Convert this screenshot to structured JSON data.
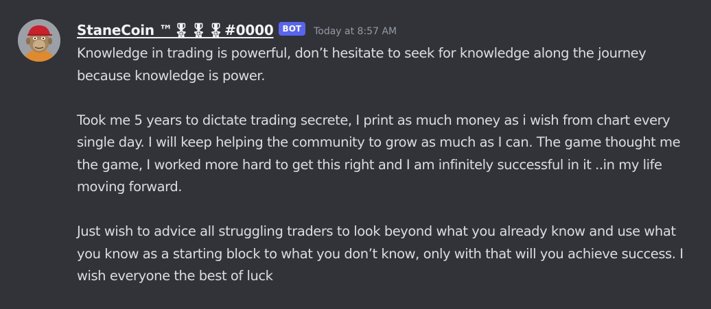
{
  "message": {
    "author": {
      "display_name": "StaneCoin ™🎖🎖🎖#0000",
      "bot_badge": "BOT"
    },
    "timestamp": "Today at 8:57 AM",
    "paragraphs": [
      "Knowledge in trading is powerful, don’t hesitate to seek for knowledge along the journey because knowledge is power.",
      "Took me 5 years to dictate trading secrete, I print as much money as i wish from chart every single day. I will keep helping the community to grow as much as I can. The game thought me the game, I worked more hard to get this right and I am infinitely successful in it ..in my life moving forward.",
      "Just wish to advice all struggling traders to look beyond what you already know and use what you know as a starting block to what you don’t know, only with that will you achieve success. I wish everyone the best of luck"
    ],
    "avatar_icon": "ape-avatar-icon"
  },
  "colors": {
    "background": "#313338",
    "text": "#dbdee1",
    "username": "#f2f3f5",
    "timestamp": "#949ba4",
    "bot_badge": "#5865f2"
  }
}
